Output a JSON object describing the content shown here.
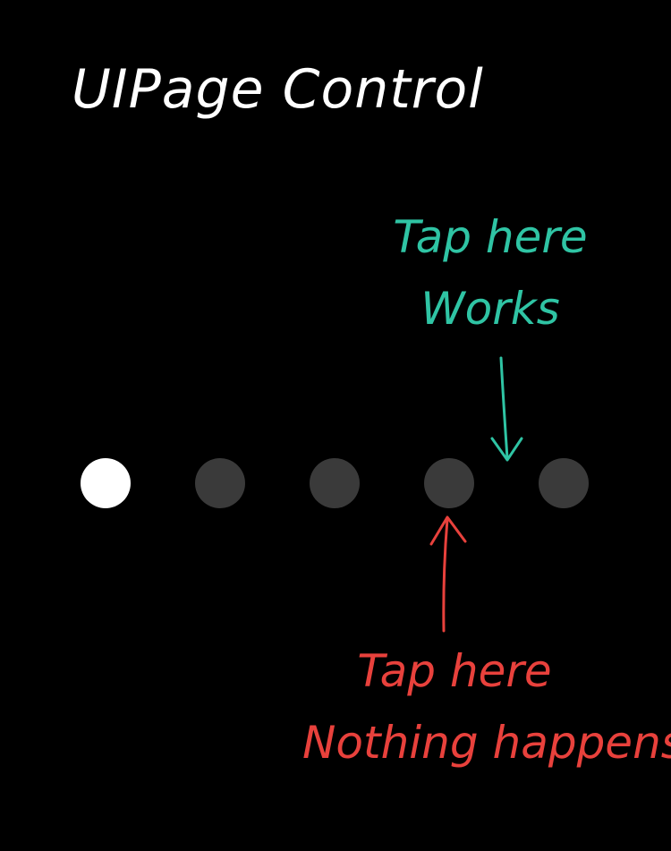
{
  "title": "UIPage Control",
  "page_control": {
    "page_count": 5,
    "current_page": 1,
    "active_color": "#ffffff",
    "inactive_color": "#3a3a3a"
  },
  "annotations": {
    "works": {
      "line1": "Tap here",
      "line2": "Works",
      "color": "#2fc4a4"
    },
    "nothing": {
      "line1": "Tap here",
      "line2": "Nothing happens",
      "color": "#e8413c"
    }
  }
}
